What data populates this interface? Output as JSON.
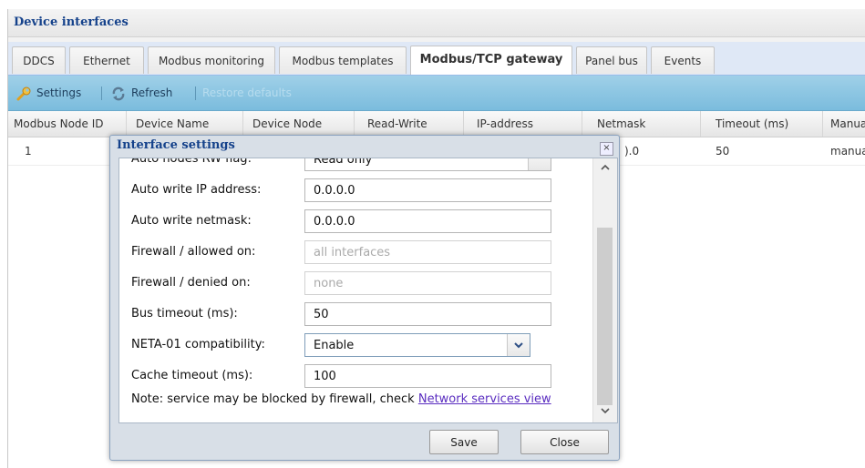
{
  "panel": {
    "title": "Device interfaces"
  },
  "tabs": [
    {
      "label": "DDCS"
    },
    {
      "label": "Ethernet"
    },
    {
      "label": "Modbus monitoring"
    },
    {
      "label": "Modbus templates"
    },
    {
      "label": "Modbus/TCP gateway",
      "active": true
    },
    {
      "label": "Panel bus"
    },
    {
      "label": "Events"
    }
  ],
  "toolbar": {
    "settings_label": "Settings",
    "refresh_label": "Refresh",
    "restore_label": "Restore defaults"
  },
  "grid": {
    "columns": [
      "Modbus Node ID",
      "Device Name",
      "Device Node",
      "Read-Write",
      "IP-address",
      "Netmask",
      "Timeout (ms)",
      "Manua"
    ],
    "rows": [
      {
        "node_id": "1",
        "netmask_fragment": ").0",
        "timeout": "50",
        "manual": "manua"
      }
    ]
  },
  "dialog": {
    "title": "Interface settings",
    "partial_label": "Auto nodes RW flag:",
    "partial_value": "Read only",
    "fields": [
      {
        "label": "Auto write IP address:",
        "value": "0.0.0.0"
      },
      {
        "label": "Auto write netmask:",
        "value": "0.0.0.0"
      },
      {
        "label": "Firewall / allowed on:",
        "value": "all interfaces"
      },
      {
        "label": "Firewall / denied on:",
        "value": "none"
      },
      {
        "label": "Bus timeout (ms):",
        "value": "50"
      },
      {
        "label": "NETA-01 compatibility:",
        "value": "Enable"
      },
      {
        "label": "Cache timeout (ms):",
        "value": "100"
      }
    ],
    "note_text": "Note: service may be blocked by firewall, check ",
    "note_link": "Network services view",
    "save_label": "Save",
    "close_label": "Close",
    "close_icon": "×"
  },
  "colors": {
    "accent": "#15428b",
    "toolbar": "#8dc6e2",
    "link": "#5a2dc0"
  }
}
